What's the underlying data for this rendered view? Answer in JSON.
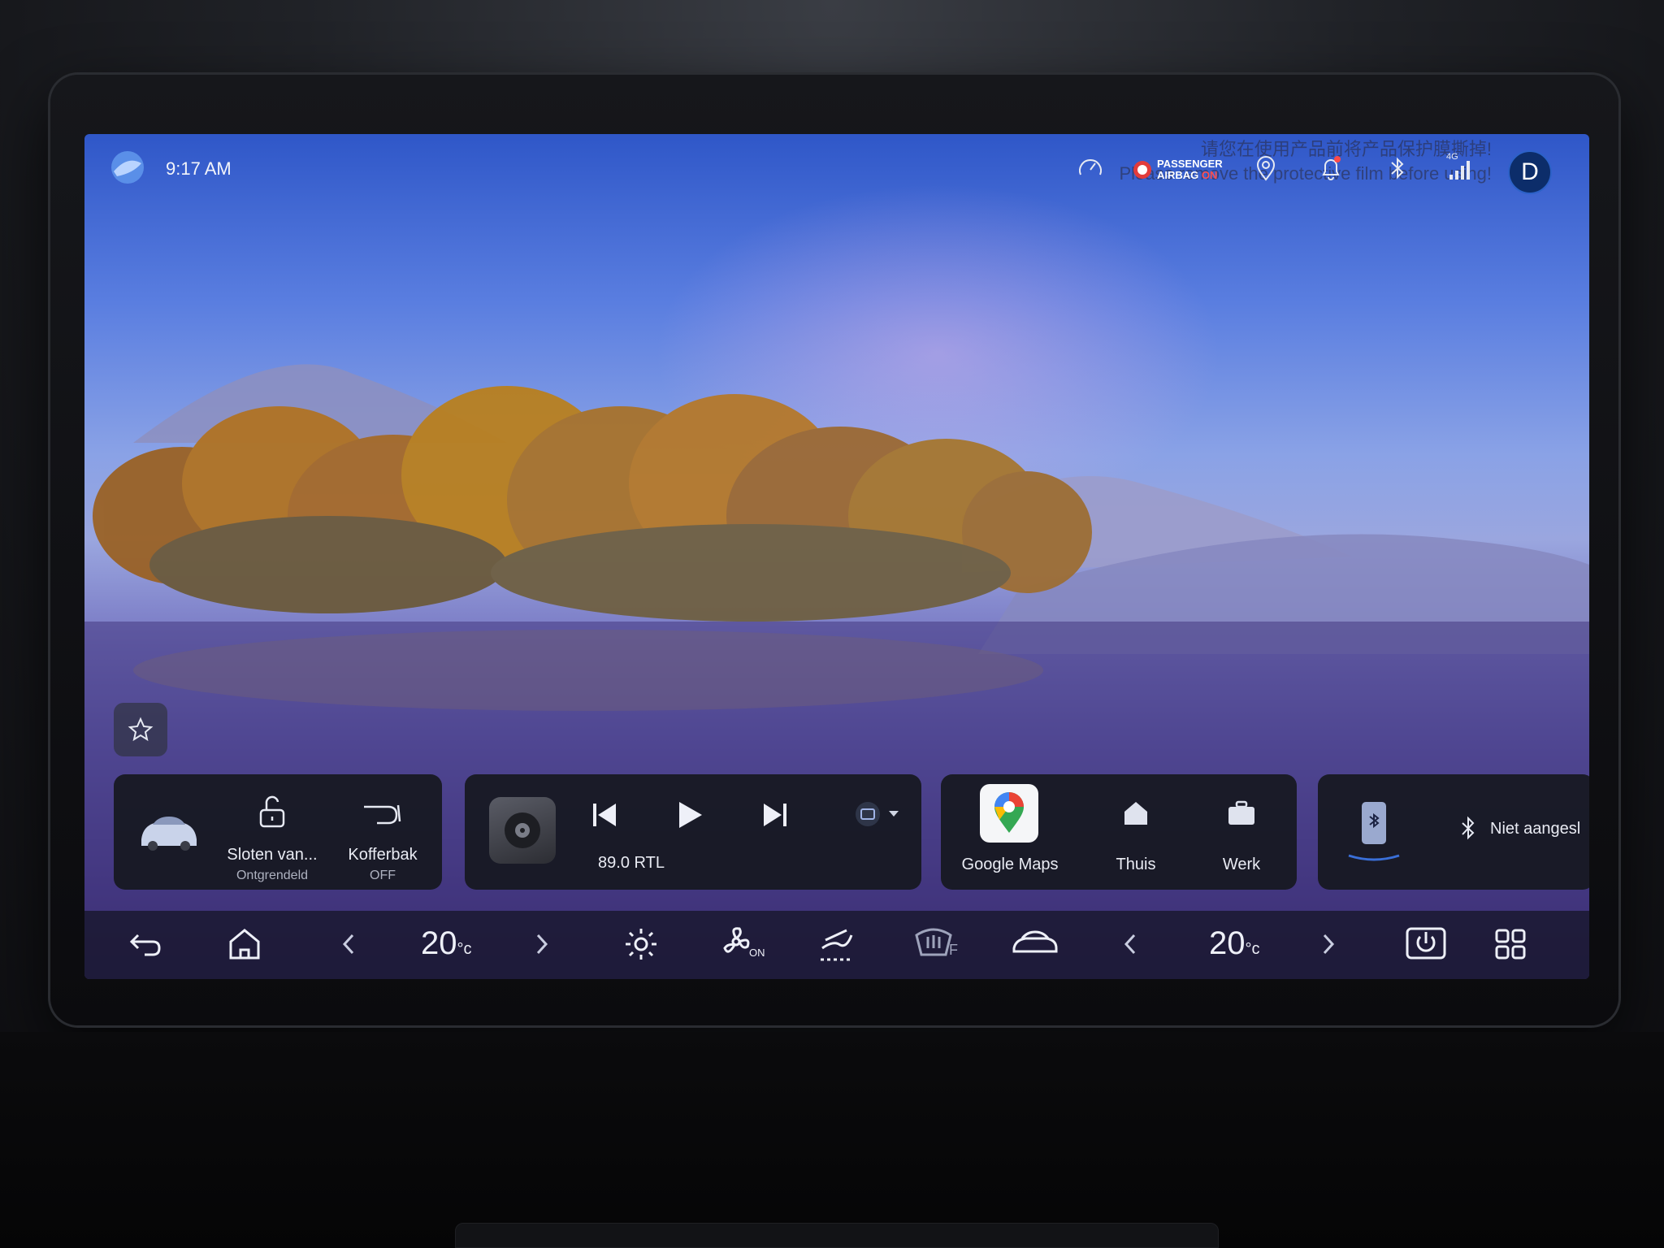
{
  "screen_notice": {
    "line1": "请您在使用产品前将产品保护膜撕掉!",
    "line2": "Please remove the protective film before using!"
  },
  "status_bar": {
    "time": "9:17 AM",
    "airbag": {
      "line1": "PASSENGER",
      "line2_prefix": "AIRBAG",
      "line2_state": "ON"
    },
    "network": "4G",
    "user_initial": "D",
    "icons": [
      "speedometer-icon",
      "airbag-status-icon",
      "location-pin-icon",
      "notification-bell-icon",
      "bluetooth-icon",
      "signal-icon"
    ]
  },
  "car_widget": {
    "lock_label": "Sloten van...",
    "lock_state": "Ontgrendeld",
    "trunk_label": "Kofferbak",
    "trunk_state": "OFF"
  },
  "media_widget": {
    "station": "89.0 RTL",
    "controls": [
      "previous-track-icon",
      "play-icon",
      "next-track-icon"
    ]
  },
  "nav_widget": {
    "items": [
      {
        "label": "Google Maps",
        "icon": "google-maps-icon"
      },
      {
        "label": "Thuis",
        "icon": "home-icon"
      },
      {
        "label": "Werk",
        "icon": "briefcase-icon"
      }
    ]
  },
  "phone_widget": {
    "status": "Niet aangesl"
  },
  "bottom_bar": {
    "left_temp": "20",
    "right_temp": "20",
    "temp_unit": "°c",
    "fan_state": "ON",
    "defrost_label": "F"
  },
  "colors": {
    "accent_blue": "#2c61c8",
    "alert_red": "#ff5050",
    "widget_bg": "#16181f"
  }
}
